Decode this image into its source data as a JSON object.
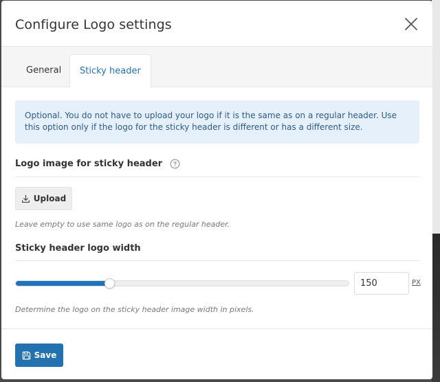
{
  "modal": {
    "title": "Configure Logo settings",
    "close_icon": "close-icon"
  },
  "tabs": [
    {
      "label": "General",
      "active": false
    },
    {
      "label": "Sticky header",
      "active": true
    }
  ],
  "notice": {
    "text": "Optional. You do not have to upload your logo if it is the same as on a regular header. Use this option only if the logo for the sticky header is different or has a different size."
  },
  "logo_image": {
    "label": "Logo image for sticky header",
    "help_icon": "question-circle-icon",
    "upload_label": "Upload",
    "upload_icon": "download-icon",
    "hint": "Leave empty to use same logo as on the regular header."
  },
  "logo_width": {
    "label": "Sticky header logo width",
    "value": "150",
    "slider_fraction": 0.28,
    "unit": "PX",
    "hint": "Determine the logo on the sticky header image width in pixels."
  },
  "footer": {
    "save_label": "Save",
    "save_icon": "floppy-disk-icon"
  },
  "colors": {
    "accent": "#1e73be",
    "notice_bg": "#e6f0fa",
    "button_primary": "#2271b1"
  }
}
